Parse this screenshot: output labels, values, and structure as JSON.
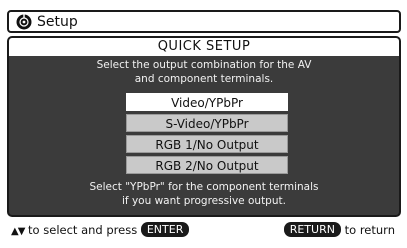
{
  "header": {
    "title": "Setup",
    "icon": "setup-disc-icon"
  },
  "panel": {
    "heading": "QUICK SETUP",
    "description_line1": "Select the output combination for the AV",
    "description_line2": "and component terminals.",
    "options": [
      {
        "label": "Video/YPbPr",
        "selected": true
      },
      {
        "label": "S-Video/YPbPr",
        "selected": false
      },
      {
        "label": "RGB 1/No Output",
        "selected": false
      },
      {
        "label": "RGB 2/No Output",
        "selected": false
      }
    ],
    "note_line1": "Select \"YPbPr\" for the component terminals",
    "note_line2": "if you want progressive output."
  },
  "footer": {
    "arrows": "▲▼",
    "select_text": "to select and press",
    "enter_key": "ENTER",
    "return_key": "RETURN",
    "return_text": "to return"
  },
  "colors": {
    "panel_background": "#3b3b3b",
    "selected_option": "#ffffff",
    "unselected_option": "#c9c9c9",
    "key_background": "#1a1a1a"
  }
}
